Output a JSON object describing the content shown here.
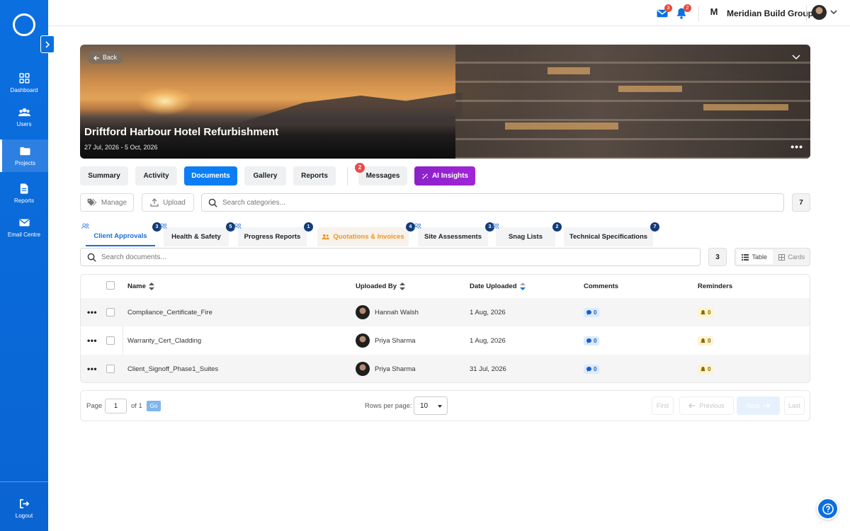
{
  "sidebar": {
    "items": [
      {
        "label": "Dashboard",
        "icon": "dashboard-icon"
      },
      {
        "label": "Users",
        "icon": "users-icon"
      },
      {
        "label": "Projects",
        "icon": "folder-icon"
      },
      {
        "label": "Reports",
        "icon": "document-icon"
      },
      {
        "label": "Email Centre",
        "icon": "mail-icon"
      }
    ],
    "logout": "Logout"
  },
  "topbar": {
    "mail_badge": "3",
    "bell_badge": "2",
    "company_logo": "M",
    "company_name": "Meridian Build Group"
  },
  "hero": {
    "back_label": "Back",
    "title": "Driftford Harbour Hotel Refurbishment",
    "dates": "27 Jul, 2026 - 5 Oct, 2026",
    "more": "•••"
  },
  "tabs": {
    "summary": "Summary",
    "activity": "Activity",
    "documents": "Documents",
    "gallery": "Gallery",
    "reports": "Reports",
    "messages": "Messages",
    "messages_badge": "2",
    "ai": "AI Insights"
  },
  "actions": {
    "manage": "Manage",
    "upload": "Upload",
    "search_categories_placeholder": "Search categories...",
    "category_count": "7"
  },
  "categories": [
    {
      "label": "Client Approvals",
      "badge": "3"
    },
    {
      "label": "Health & Safety",
      "badge": "5"
    },
    {
      "label": "Progress Reports",
      "badge": "1"
    },
    {
      "label": "Quotations & Invoices",
      "badge": "4"
    },
    {
      "label": "Site Assessments",
      "badge": "3"
    },
    {
      "label": "Snag Lists",
      "badge": "2"
    },
    {
      "label": "Technical Specifications",
      "badge": "7"
    }
  ],
  "documents": {
    "search_placeholder": "Search documents...",
    "count": "3",
    "view_table": "Table",
    "view_cards": "Cards"
  },
  "table": {
    "headers": {
      "name": "Name",
      "uploaded_by": "Uploaded By",
      "date": "Date Uploaded",
      "comments": "Comments",
      "reminders": "Reminders"
    },
    "rows": [
      {
        "name": "Compliance_Certificate_Fire",
        "uploader": "Hannah Walsh",
        "date": "1 Aug, 2026",
        "comments": "0",
        "reminders": "0"
      },
      {
        "name": "Warranty_Cert_Cladding",
        "uploader": "Priya Sharma",
        "date": "1 Aug, 2026",
        "comments": "0",
        "reminders": "0"
      },
      {
        "name": "Client_Signoff_Phase1_Suites",
        "uploader": "Priya Sharma",
        "date": "31 Jul, 2026",
        "comments": "0",
        "reminders": "0"
      }
    ]
  },
  "pagination": {
    "page_label": "Page",
    "page_value": "1",
    "of_label": "of 1",
    "go": "Go",
    "rows_label": "Rows per page:",
    "rows_value": "10",
    "first": "First",
    "previous": "Previous",
    "next": "Next",
    "last": "Last"
  },
  "colors": {
    "primary": "#0b6fe0",
    "active_tab": "#0b7ef3",
    "ai": "#a125d6",
    "badge_red": "#ea4b4b",
    "orange": "#f39322"
  }
}
